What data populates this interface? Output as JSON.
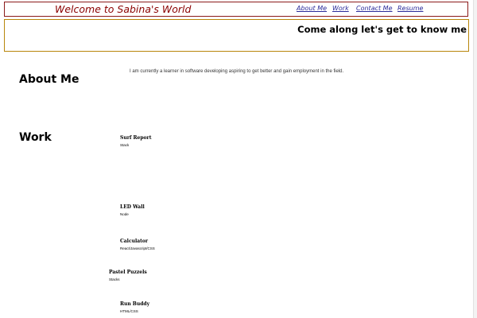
{
  "header": {
    "site_title": "Welcome to Sabina's World",
    "nav": {
      "about": "About Me",
      "work": "Work",
      "contact": "Contact Me",
      "resume": "Resume"
    }
  },
  "hero": {
    "tagline": "Come along let's get to know me"
  },
  "about": {
    "heading": "About Me",
    "text": "I am currently a learner in software developing aspiring to get better and gain employment in the field."
  },
  "work": {
    "heading": "Work",
    "projects": [
      {
        "title": "Surf Report",
        "stack": "Stack"
      },
      {
        "title": "LED Wall",
        "stack": "Node"
      },
      {
        "title": "Calculator",
        "stack": "React/Javascript/CSS"
      },
      {
        "title": "Pastel Puzzels",
        "stack": "Stacks"
      },
      {
        "title": "Run Buddy",
        "stack": "HTML/CSS"
      }
    ]
  },
  "colors": {
    "title_red": "#8b0000",
    "header_border": "#8b1a1a",
    "hero_border": "#b8860b",
    "nav_link": "#2a2a9a"
  }
}
